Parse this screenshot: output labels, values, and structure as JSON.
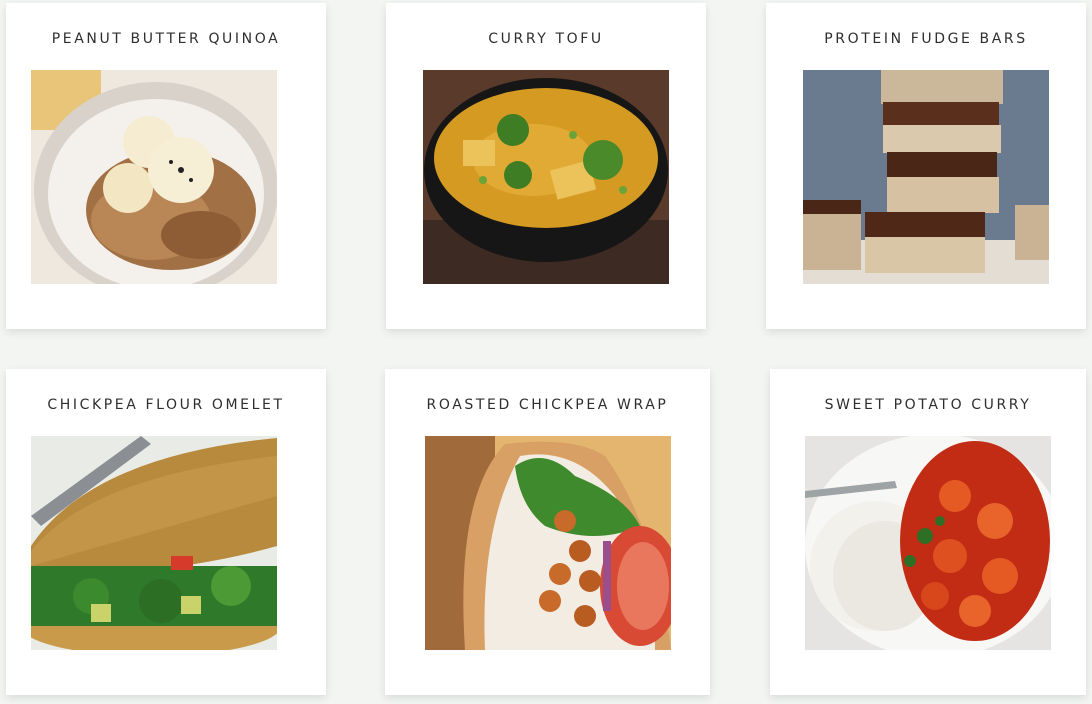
{
  "recipes": [
    {
      "title": "PEANUT BUTTER QUINOA",
      "image": "peanut-butter-quinoa-bowl-photo"
    },
    {
      "title": "CURRY TOFU",
      "image": "curry-tofu-bowl-photo"
    },
    {
      "title": "PROTEIN FUDGE BARS",
      "image": "protein-fudge-bars-stack-photo"
    },
    {
      "title": "CHICKPEA FLOUR OMELET",
      "image": "chickpea-flour-omelet-photo"
    },
    {
      "title": "ROASTED CHICKPEA WRAP",
      "image": "roasted-chickpea-wrap-photo"
    },
    {
      "title": "SWEET POTATO CURRY",
      "image": "sweet-potato-curry-plate-photo"
    }
  ],
  "colors": {
    "page_background": "#f2f5f2",
    "card_background": "#ffffff",
    "title_text": "#2e2e2e"
  }
}
